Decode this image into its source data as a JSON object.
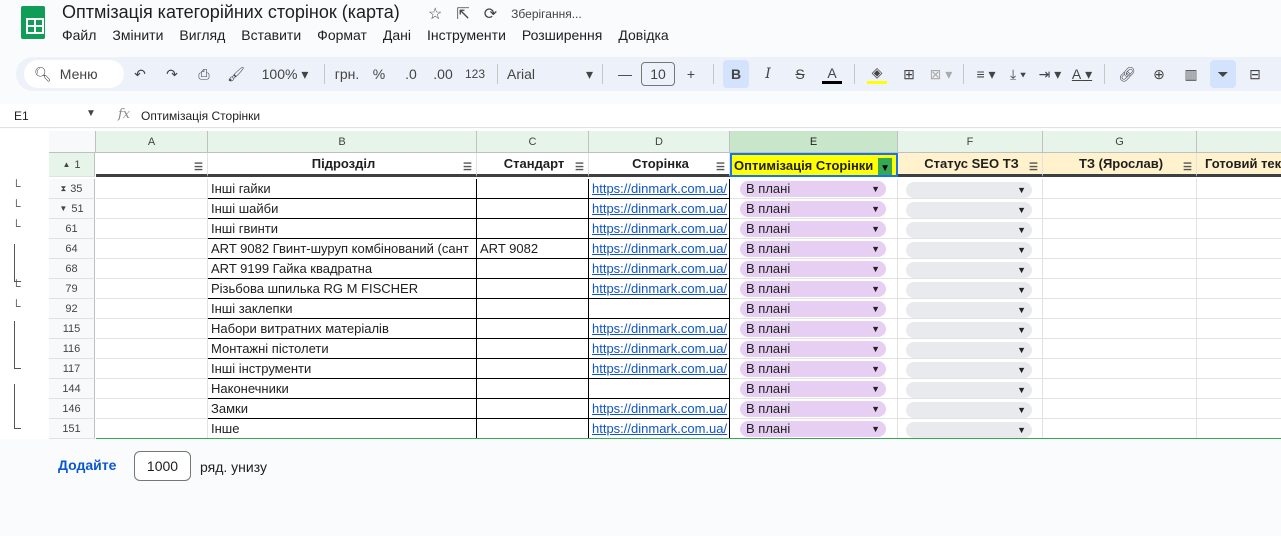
{
  "app": {
    "title": "Оптмізація категорійних сторінок (карта)",
    "saving_status": "Зберігання...",
    "menu": [
      "Файл",
      "Змінити",
      "Вигляд",
      "Вставити",
      "Формат",
      "Дані",
      "Інструменти",
      "Розширення",
      "Довідка"
    ]
  },
  "toolbar": {
    "search_label": "Меню",
    "zoom": "100%",
    "currency": "грн.",
    "percent": "%",
    "dec_less": ".0",
    "dec_more": ".00",
    "format_123": "123",
    "font": "Arial",
    "font_size": "10",
    "bold": "B",
    "italic": "I",
    "strike": "S",
    "text_color": "A",
    "text_rotation": "A"
  },
  "formula_bar": {
    "cell_ref": "E1",
    "fx": "fx",
    "content": "Оптимізація Сторінки"
  },
  "columns": [
    "A",
    "B",
    "C",
    "D",
    "E",
    "F",
    "G"
  ],
  "header_row": {
    "row_num": "1",
    "A": "",
    "B": "Підрозділ",
    "C": "Стандарт",
    "D": "Сторінка",
    "E": "Оптимізація Сторінки",
    "F": "Статус SEO ТЗ",
    "G": "ТЗ (Ярослав)",
    "H": "Готовий тек"
  },
  "rows": [
    {
      "num": "35",
      "B": "Інші гайки",
      "C": "",
      "D": "https://dinmark.com.ua/",
      "E": "В плані"
    },
    {
      "num": "51",
      "B": "Інші шайби",
      "C": "",
      "D": "https://dinmark.com.ua/",
      "E": "В плані"
    },
    {
      "num": "61",
      "B": "Інші гвинти",
      "C": "",
      "D": "https://dinmark.com.ua/",
      "E": "В плані"
    },
    {
      "num": "64",
      "B": "ART 9082 Гвинт-шуруп комбінований (сант",
      "C": "ART 9082",
      "D": "https://dinmark.com.ua/",
      "E": "В плані"
    },
    {
      "num": "68",
      "B": "ART 9199 Гайка квадратна",
      "C": "",
      "D": "https://dinmark.com.ua/",
      "E": "В плані"
    },
    {
      "num": "79",
      "B": "Різьбова шпилька RG M FISCHER",
      "C": "",
      "D": "https://dinmark.com.ua/",
      "E": "В плані"
    },
    {
      "num": "92",
      "B": "Інші  заклепки",
      "C": "",
      "D": "",
      "E": "В плані"
    },
    {
      "num": "115",
      "B": "Набори витратних матеріалів",
      "C": "",
      "D": "https://dinmark.com.ua/",
      "E": "В плані"
    },
    {
      "num": "116",
      "B": "Монтажні пістолети",
      "C": "",
      "D": "https://dinmark.com.ua/",
      "E": "В плані"
    },
    {
      "num": "117",
      "B": "Інші інструменти",
      "C": "",
      "D": "https://dinmark.com.ua/",
      "E": "В плані"
    },
    {
      "num": "144",
      "B": "Наконечники",
      "C": "",
      "D": "",
      "E": "В плані"
    },
    {
      "num": "146",
      "B": "Замки",
      "C": "",
      "D": "https://dinmark.com.ua/",
      "E": "В плані"
    },
    {
      "num": "151",
      "B": "Інше",
      "C": "",
      "D": "https://dinmark.com.ua/",
      "E": "В плані"
    }
  ],
  "footer": {
    "add_label": "Додайте",
    "add_count": "1000",
    "add_suffix": "ряд. унизу"
  },
  "colors": {
    "accent_blue": "#0b57d0",
    "chip_purple": "#e6cff2",
    "chip_grey": "#e8eaed",
    "header_E_bg": "#ffff00",
    "filter_green": "#34a853"
  }
}
